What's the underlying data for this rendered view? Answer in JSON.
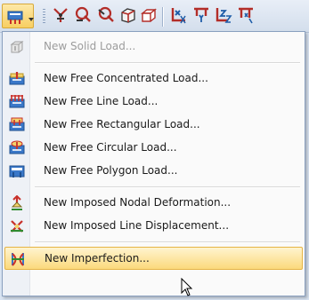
{
  "toolbar": {
    "buttons": [
      {
        "icon": "load-wizard-icon"
      },
      {
        "icon": "nodal-load-icon"
      },
      {
        "icon": "member-load-icon"
      },
      {
        "icon": "line-load-icon"
      },
      {
        "icon": "surface-load-icon"
      },
      {
        "icon": "solid-load-icon"
      },
      {
        "icon": "support-x-icon"
      },
      {
        "icon": "support-y-icon"
      },
      {
        "icon": "support-z-icon"
      },
      {
        "icon": "support-rotation-icon"
      }
    ]
  },
  "menu": {
    "items": [
      {
        "label": "New Solid Load...",
        "icon": "solid-load-icon",
        "enabled": false
      },
      {
        "label": "New Free Concentrated Load...",
        "icon": "free-concentrated-load-icon",
        "enabled": true
      },
      {
        "label": "New Free Line Load...",
        "icon": "free-line-load-icon",
        "enabled": true
      },
      {
        "label": "New Free Rectangular Load...",
        "icon": "free-rectangular-load-icon",
        "enabled": true
      },
      {
        "label": "New Free Circular Load...",
        "icon": "free-circular-load-icon",
        "enabled": true
      },
      {
        "label": "New Free Polygon Load...",
        "icon": "free-polygon-load-icon",
        "enabled": true
      },
      {
        "label": "New Imposed Nodal Deformation...",
        "icon": "imposed-nodal-deformation-icon",
        "enabled": true
      },
      {
        "label": "New Imposed Line Displacement...",
        "icon": "imposed-line-displacement-icon",
        "enabled": true
      },
      {
        "label": "New Imperfection...",
        "icon": "imperfection-icon",
        "enabled": true,
        "highlighted": true
      }
    ]
  },
  "colors": {
    "highlight": "#fbd97c",
    "highlight_border": "#e5b445",
    "disabled_text": "#9c9c9c"
  }
}
